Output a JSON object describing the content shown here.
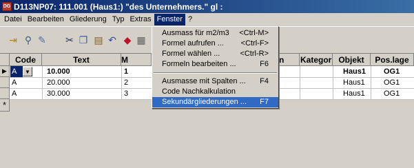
{
  "window": {
    "title": "D113NP07: 111.001    (Haus1:) \"des Unternehmers.\" gl :",
    "icon": "DG"
  },
  "menubar": [
    "Datei",
    "Bearbeiten",
    "Gliederung",
    "Typ",
    "Extras",
    "Fenster",
    "?"
  ],
  "active_menu": "Fenster",
  "toolbar": {
    "icons": [
      "open-icon",
      "search-icon",
      "edit-icon",
      "cut-icon",
      "copy-icon",
      "paste-icon",
      "undo-icon",
      "eraser-icon",
      "calc-icon"
    ]
  },
  "fenster_menu": {
    "items": [
      {
        "label": "Ausmass für m2/m3",
        "shortcut": "<Ctrl-M>"
      },
      {
        "label": "Formel aufrufen ...",
        "shortcut": "<Ctrl-F>"
      },
      {
        "label": "Formel wählen ...",
        "shortcut": "<Ctrl-R>"
      },
      {
        "label": "Formeln bearbeiten ...",
        "shortcut": "F6"
      },
      {
        "label": "Ausmasse mit Spalten ...",
        "shortcut": "F4"
      },
      {
        "label": "Code Nachkalkulation",
        "shortcut": ""
      },
      {
        "label": "Sekundärgliederungen ...",
        "shortcut": "F7"
      }
    ]
  },
  "grid": {
    "columns": [
      "Code",
      "Text",
      "M",
      "n",
      "Kategor",
      "Objekt",
      "Pos.lage"
    ],
    "rows": [
      {
        "code": "A",
        "text": "10.000",
        "m": "1",
        "objekt": "Haus1",
        "poslage": "OG1"
      },
      {
        "code": "A",
        "text": "20.000",
        "m": "2",
        "objekt": "Haus1",
        "poslage": "OG1"
      },
      {
        "code": "A",
        "text": "30.000",
        "m": "3",
        "objekt": "Haus1",
        "poslage": "OG1"
      }
    ],
    "new_row_marker": "*",
    "current_row_marker": "▶",
    "combo_arrow": "▼"
  }
}
